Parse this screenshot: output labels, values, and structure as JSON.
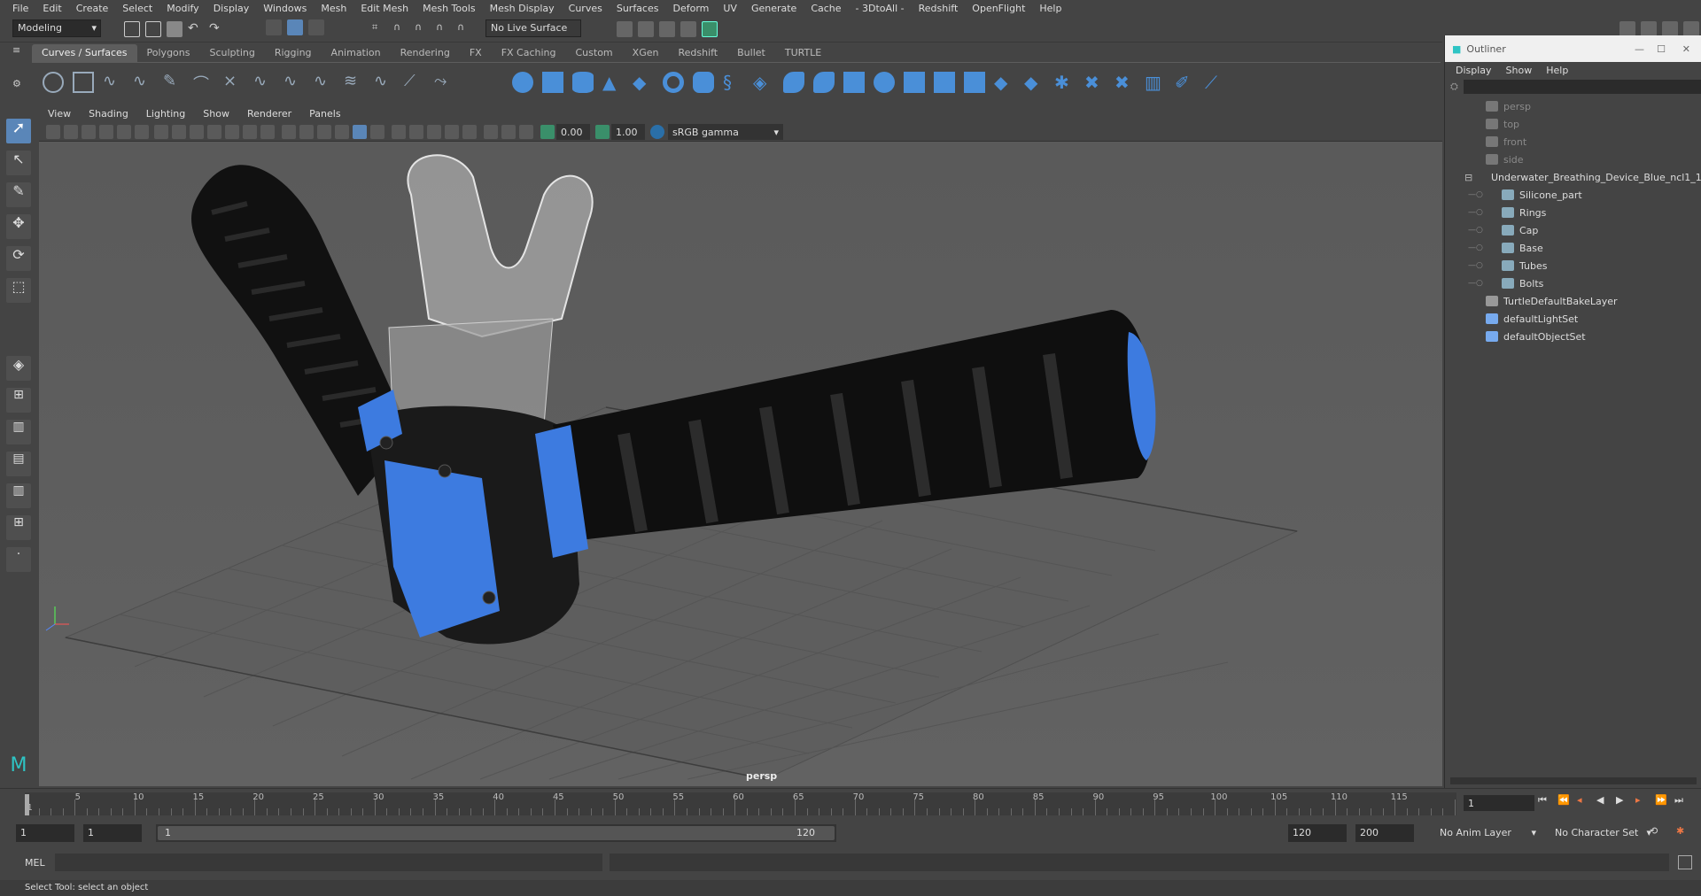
{
  "menubar": {
    "items": [
      "File",
      "Edit",
      "Create",
      "Select",
      "Modify",
      "Display",
      "Windows",
      "Mesh",
      "Edit Mesh",
      "Mesh Tools",
      "Mesh Display",
      "Curves",
      "Surfaces",
      "Deform",
      "UV",
      "Generate",
      "Cache",
      "- 3DtoAll -",
      "Redshift",
      "OpenFlight",
      "Help"
    ]
  },
  "statusline": {
    "workspace": "Modeling",
    "live_surface": "No Live Surface"
  },
  "shelf": {
    "tabs": [
      "Curves / Surfaces",
      "Polygons",
      "Sculpting",
      "Rigging",
      "Animation",
      "Rendering",
      "FX",
      "FX Caching",
      "Custom",
      "XGen",
      "Redshift",
      "Bullet",
      "TURTLE"
    ],
    "active_tab": "Curves / Surfaces"
  },
  "panel": {
    "menus": [
      "View",
      "Shading",
      "Lighting",
      "Show",
      "Renderer",
      "Panels"
    ],
    "exposure": "0.00",
    "gamma": "1.00",
    "color_space": "sRGB gamma",
    "camera_label": "persp"
  },
  "outliner": {
    "title": "Outliner",
    "menus": [
      "Display",
      "Show",
      "Help"
    ],
    "items": [
      {
        "label": "persp",
        "type": "camera",
        "indent": 0,
        "dim": true
      },
      {
        "label": "top",
        "type": "camera",
        "indent": 0,
        "dim": true
      },
      {
        "label": "front",
        "type": "camera",
        "indent": 0,
        "dim": true
      },
      {
        "label": "side",
        "type": "camera",
        "indent": 0,
        "dim": true
      },
      {
        "label": "Underwater_Breathing_Device_Blue_ncl1_1",
        "type": "group",
        "indent": 0,
        "dim": false,
        "expanded": true
      },
      {
        "label": "Silicone_part",
        "type": "mesh",
        "indent": 1,
        "dim": false
      },
      {
        "label": "Rings",
        "type": "mesh",
        "indent": 1,
        "dim": false
      },
      {
        "label": "Cap",
        "type": "mesh",
        "indent": 1,
        "dim": false
      },
      {
        "label": "Base",
        "type": "mesh",
        "indent": 1,
        "dim": false
      },
      {
        "label": "Tubes",
        "type": "mesh",
        "indent": 1,
        "dim": false
      },
      {
        "label": "Bolts",
        "type": "mesh",
        "indent": 1,
        "dim": false
      },
      {
        "label": "TurtleDefaultBakeLayer",
        "type": "layer",
        "indent": 0,
        "dim": false
      },
      {
        "label": "defaultLightSet",
        "type": "set",
        "indent": 0,
        "dim": false
      },
      {
        "label": "defaultObjectSet",
        "type": "set",
        "indent": 0,
        "dim": false
      }
    ]
  },
  "timeline": {
    "tick_labels": [
      "1",
      "5",
      "10",
      "15",
      "20",
      "25",
      "30",
      "35",
      "40",
      "45",
      "50",
      "55",
      "60",
      "65",
      "70",
      "75",
      "80",
      "85",
      "90",
      "95",
      "100",
      "105",
      "110",
      "115"
    ],
    "current_frame": "1"
  },
  "range": {
    "start": "1",
    "playback_start": "1",
    "slider_start": "1",
    "slider_end": "120",
    "playback_end": "120",
    "end": "200",
    "anim_layer": "No Anim Layer",
    "character_set": "No Character Set"
  },
  "cmdline": {
    "label": "MEL"
  },
  "helpline": {
    "text": "Select Tool: select an object"
  },
  "colors": {
    "accent": "#3d7be0",
    "bg": "#444444",
    "viewport": "#5e5e5e"
  }
}
